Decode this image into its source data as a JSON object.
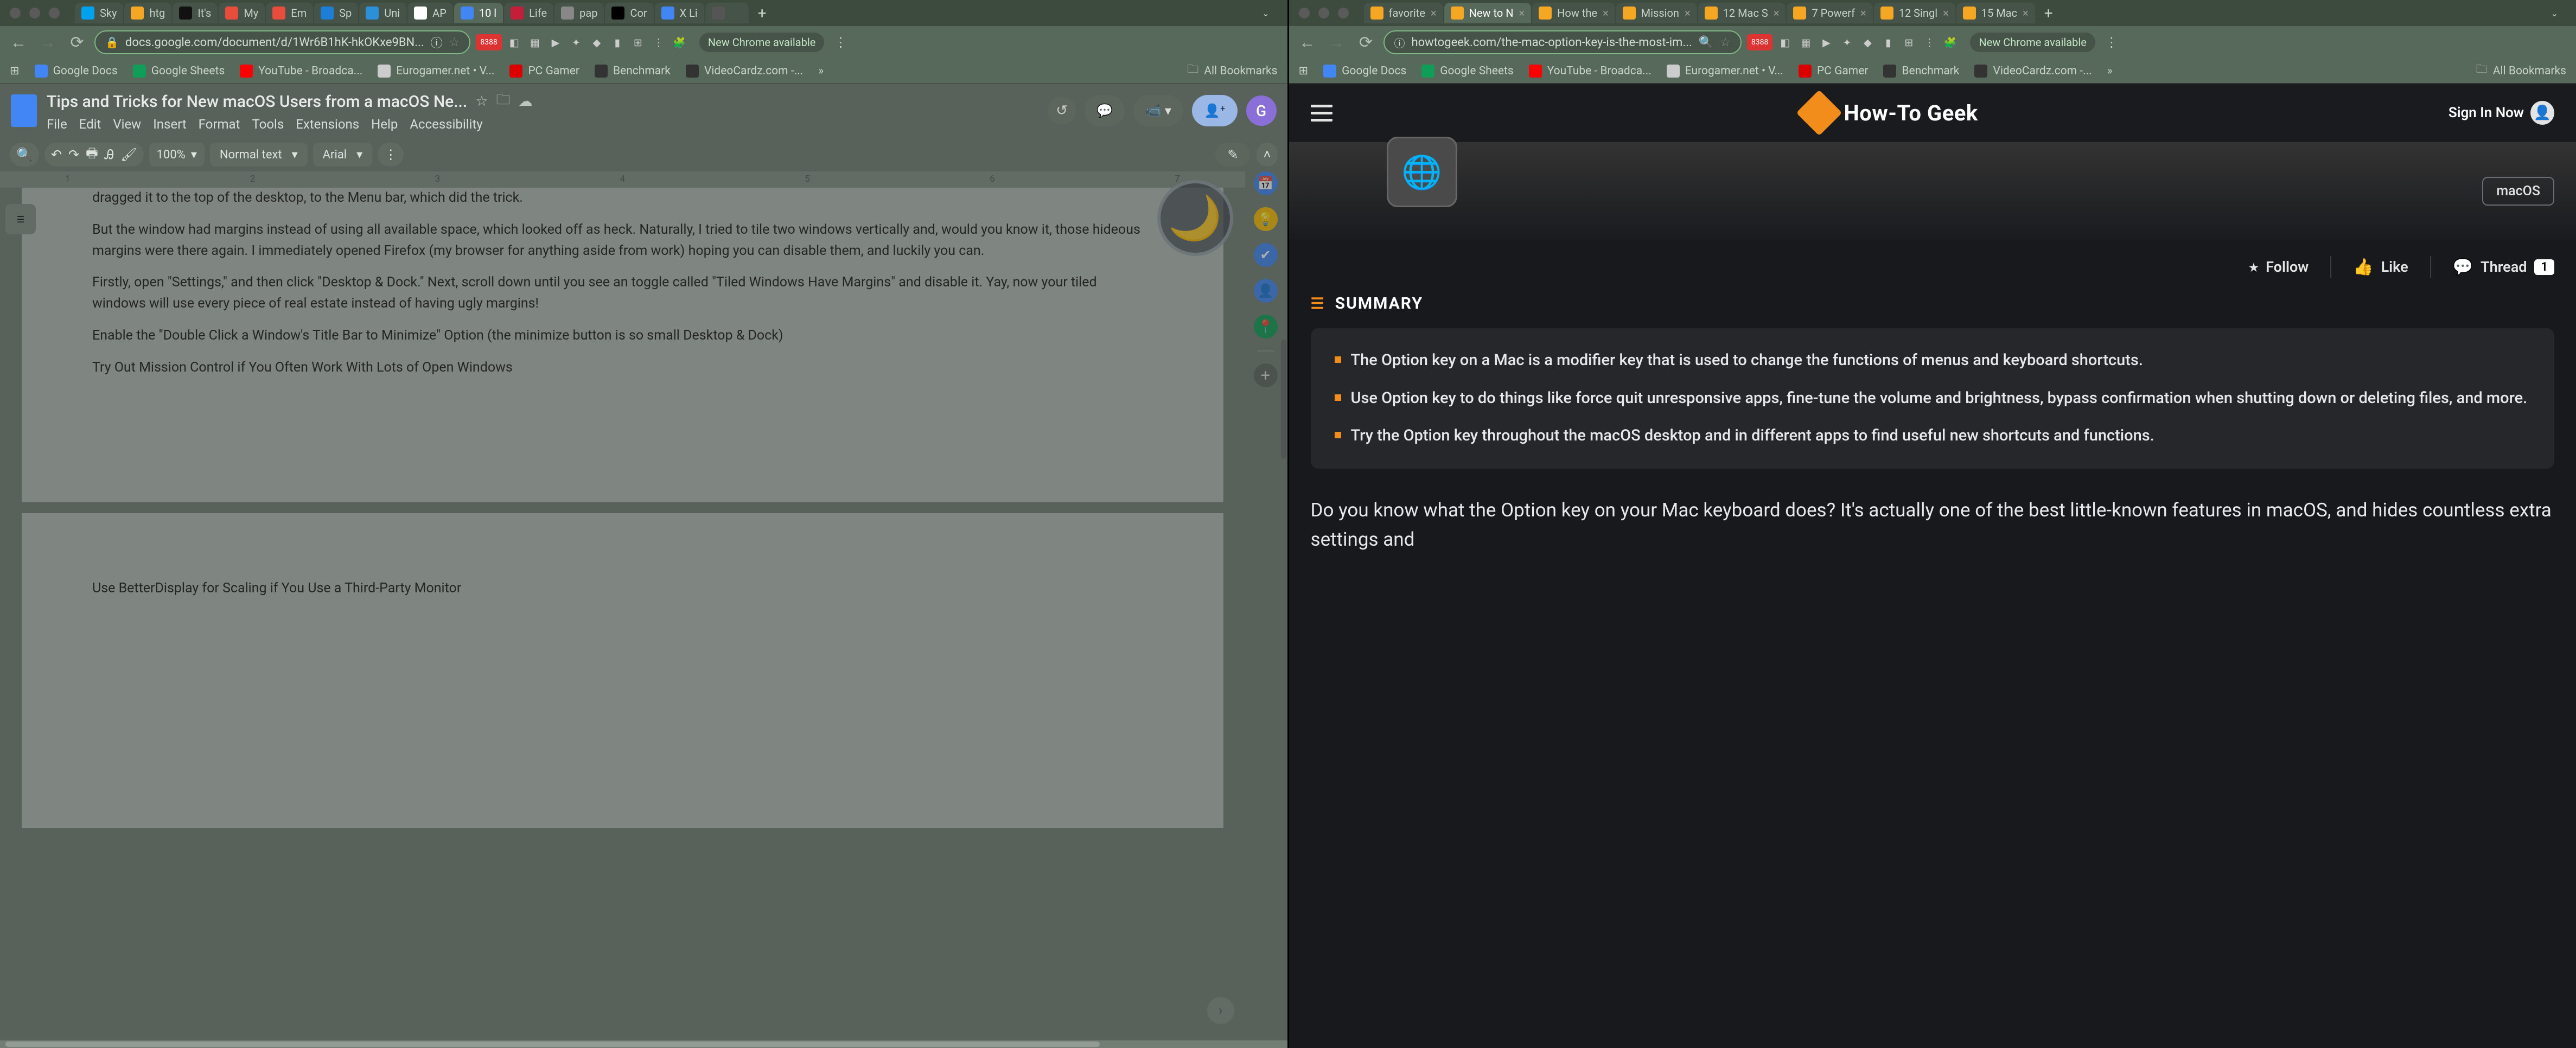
{
  "left": {
    "tabs": [
      {
        "fav": "fav-sky",
        "label": "Sky"
      },
      {
        "fav": "fav-htg",
        "label": "htg"
      },
      {
        "fav": "fav-its",
        "label": "It's"
      },
      {
        "fav": "fav-my",
        "label": "My"
      },
      {
        "fav": "fav-em",
        "label": "Em"
      },
      {
        "fav": "fav-sp",
        "label": "Sp"
      },
      {
        "fav": "fav-un",
        "label": "Uni"
      },
      {
        "fav": "fav-ap",
        "label": "AP"
      },
      {
        "fav": "fav-gdoc",
        "label": "10 l"
      },
      {
        "fav": "fav-life",
        "label": "Life"
      },
      {
        "fav": "fav-pap",
        "label": "pap"
      },
      {
        "fav": "fav-con",
        "label": "Cor"
      },
      {
        "fav": "fav-xli",
        "label": "X Li"
      },
      {
        "fav": "fav-ex",
        "label": ""
      }
    ],
    "url": "docs.google.com/document/d/1Wr6B1hK-hkOKxe9BN...",
    "chrome_avail": "New Chrome available",
    "bookmarks": [
      {
        "fav": "bm-gdoc",
        "label": "Google Docs"
      },
      {
        "fav": "bm-gsheet",
        "label": "Google Sheets"
      },
      {
        "fav": "bm-yt",
        "label": "YouTube - Broadca..."
      },
      {
        "fav": "bm-euro",
        "label": "Eurogamer.net • V..."
      },
      {
        "fav": "bm-pcg",
        "label": "PC Gamer"
      },
      {
        "fav": "bm-bench",
        "label": "Benchmark"
      },
      {
        "fav": "bm-vc",
        "label": "VideoCardz.com -..."
      }
    ],
    "all_bookmarks": "All Bookmarks",
    "doc_title": "Tips and Tricks for New macOS Users from a macOS Ne...",
    "menus": [
      "File",
      "Edit",
      "View",
      "Insert",
      "Format",
      "Tools",
      "Extensions",
      "Help",
      "Accessibility"
    ],
    "zoom": "100%",
    "style": "Normal text",
    "font": "Arial",
    "avatar_letter": "G",
    "ruler_marks": [
      "1",
      "2",
      "3",
      "4",
      "5",
      "6",
      "7"
    ],
    "paragraphs": [
      "dragged it to the top of  the desktop, to the Menu bar, which did the trick.",
      "But the window had margins instead of using all available space, which looked off as heck. Naturally, I tried to tile two windows vertically and, would you know it, those hideous margins were there again. I immediately opened Firefox (my browser for anything aside from work) hoping you can disable them, and luckily you can.",
      "Firstly, open \"Settings,\" and then click \"Desktop & Dock.\" Next, scroll down until you see an toggle called \"Tiled Windows Have Margins\" and disable it. Yay, now your tiled windows will use every piece of real estate instead of having ugly margins!",
      "Enable the \"Double Click a Window's Title Bar to Minimize\" Option (the minimize button is so small Desktop & Dock)",
      "Try Out Mission Control if You Often Work With Lots of Open Windows"
    ],
    "page2_text": "Use BetterDisplay for Scaling if You Use a Third-Party Monitor"
  },
  "right": {
    "tabs": [
      {
        "fav": "fav-htg",
        "label": "favorite"
      },
      {
        "fav": "fav-htg",
        "label": "New to N",
        "active": true
      },
      {
        "fav": "fav-htg",
        "label": "How the"
      },
      {
        "fav": "fav-htg",
        "label": "Mission"
      },
      {
        "fav": "fav-htg",
        "label": "12 Mac S"
      },
      {
        "fav": "fav-htg",
        "label": "7 Powerf"
      },
      {
        "fav": "fav-htg",
        "label": "12 Singl"
      },
      {
        "fav": "fav-htg",
        "label": "15 Mac"
      }
    ],
    "url": "howtogeek.com/the-mac-option-key-is-the-most-im...",
    "chrome_avail": "New Chrome available",
    "bookmarks": [
      {
        "fav": "bm-gdoc",
        "label": "Google Docs"
      },
      {
        "fav": "bm-gsheet",
        "label": "Google Sheets"
      },
      {
        "fav": "bm-yt",
        "label": "YouTube - Broadca..."
      },
      {
        "fav": "bm-euro",
        "label": "Eurogamer.net • V..."
      },
      {
        "fav": "bm-pcg",
        "label": "PC Gamer"
      },
      {
        "fav": "bm-bench",
        "label": "Benchmark"
      },
      {
        "fav": "bm-vc",
        "label": "VideoCardz.com -..."
      }
    ],
    "all_bookmarks": "All Bookmarks",
    "logo_text": "How-To Geek",
    "signin": "Sign In Now",
    "macos_badge": "macOS",
    "follow": "Follow",
    "like": "Like",
    "thread": "Thread",
    "thread_count": "1",
    "summary_title": "SUMMARY",
    "bullets": [
      "The Option key on a Mac is a modifier key that is used to change the functions of menus and keyboard shortcuts.",
      "Use Option key to do things like force quit unresponsive apps, fine-tune the volume and brightness, bypass confirmation when shutting down or deleting files, and more.",
      "Try the Option key throughout the macOS desktop and in different apps to find useful new shortcuts and functions."
    ],
    "article": "Do you know what the Option key on your Mac keyboard does? It's actually one of the best little-known features in macOS, and hides countless extra settings and"
  }
}
